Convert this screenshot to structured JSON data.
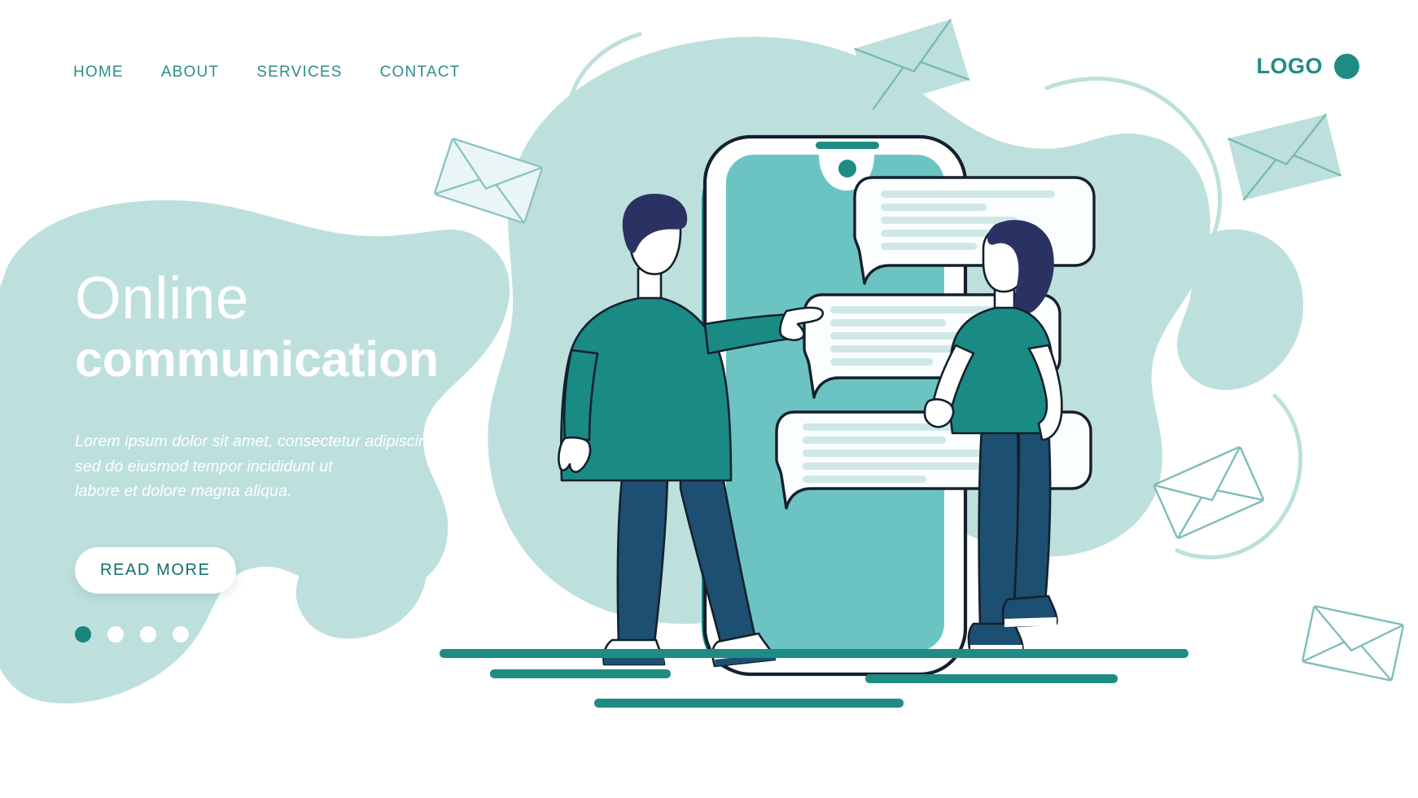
{
  "nav": {
    "items": [
      {
        "label": "HOME",
        "name": "nav-home"
      },
      {
        "label": "ABOUT",
        "name": "nav-about"
      },
      {
        "label": "SERVICES",
        "name": "nav-services"
      },
      {
        "label": "CONTACT",
        "name": "nav-contact"
      }
    ]
  },
  "logo": {
    "text": "LOGO"
  },
  "hero": {
    "title_light": "Online",
    "title_bold": "communication",
    "paragraph_line1": "Lorem ipsum dolor sit amet, consectetur adipiscing elit,",
    "paragraph_line2": "sed do eiusmod tempor incididunt ut",
    "paragraph_line3": "labore et dolore magna aliqua.",
    "cta_label": "READ MORE",
    "carousel": {
      "total": 4,
      "active_index": 0
    }
  },
  "illustration": {
    "device": "smartphone",
    "chat_bubbles": [
      {
        "name": "chat-bubble-top",
        "lines": 5
      },
      {
        "name": "chat-bubble-middle",
        "lines": 5
      },
      {
        "name": "chat-bubble-bottom",
        "lines": 5
      }
    ],
    "characters": [
      {
        "name": "character-man",
        "pose": "pointing-right"
      },
      {
        "name": "character-woman",
        "pose": "standing"
      }
    ],
    "envelopes": 5
  },
  "colors": {
    "teal_dark": "#1f8c84",
    "teal_text": "#2b8f8a",
    "teal_deep": "#0f6e6a",
    "blob_light": "#bde0dd",
    "screen_teal": "#6cc4c2",
    "navy": "#2a3264",
    "jeans": "#1d4f72",
    "sweater": "#1a8a84",
    "outline": "#14202e",
    "bubble_line": "#cfe8e6",
    "white": "#ffffff"
  }
}
